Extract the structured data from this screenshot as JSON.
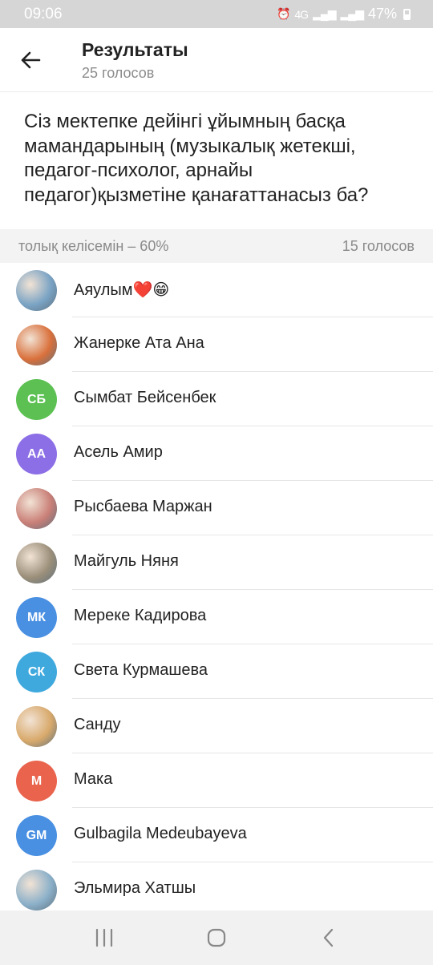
{
  "status": {
    "time": "09:06",
    "battery": "47%",
    "network_label": "4G"
  },
  "header": {
    "title": "Результаты",
    "subtitle": "25 голосов"
  },
  "question": "Сіз мектепке дейінгі ұйымның басқа мамандарының (музыкалық жетекші, педагог-психолог, арнайы педагог)қызметіне қанағаттанасыз ба?",
  "section": {
    "option_label": "толық келісемін – 60%",
    "votes": "15 голосов",
    "percent": 60
  },
  "voters": [
    {
      "name": "Аяулым❤️😁",
      "initials": "",
      "avatar_type": "photo",
      "color": "#7aa3c4"
    },
    {
      "name": "Жанерке Ата Ана",
      "initials": "",
      "avatar_type": "photo",
      "color": "#d9703b"
    },
    {
      "name": "Сымбат Бейсенбек",
      "initials": "СБ",
      "avatar_type": "initials",
      "color": "#5cc152"
    },
    {
      "name": "Асель Амир",
      "initials": "АА",
      "avatar_type": "initials",
      "color": "#8c6ee6"
    },
    {
      "name": "Рысбаева Маржан",
      "initials": "",
      "avatar_type": "photo",
      "color": "#c97f77"
    },
    {
      "name": "Майгуль Няня",
      "initials": "",
      "avatar_type": "photo",
      "color": "#9b8f7a"
    },
    {
      "name": "Мереке Кадирова",
      "initials": "МК",
      "avatar_type": "initials",
      "color": "#4a90e2"
    },
    {
      "name": "Света Курмашева",
      "initials": "СК",
      "avatar_type": "initials",
      "color": "#3fa9de"
    },
    {
      "name": "Санду",
      "initials": "",
      "avatar_type": "photo",
      "color": "#d8a96b"
    },
    {
      "name": "Мака",
      "initials": "М",
      "avatar_type": "initials",
      "color": "#e9634d"
    },
    {
      "name": "Gulbagila Medeubayeva",
      "initials": "GM",
      "avatar_type": "initials",
      "color": "#4a90e2"
    },
    {
      "name": "Эльмира Хатшы",
      "initials": "",
      "avatar_type": "photo",
      "color": "#8bb0c9"
    }
  ],
  "icons": {
    "back": "arrow-left-icon",
    "recent": "recent-apps-icon",
    "home": "home-icon",
    "nav_back": "nav-back-icon"
  }
}
